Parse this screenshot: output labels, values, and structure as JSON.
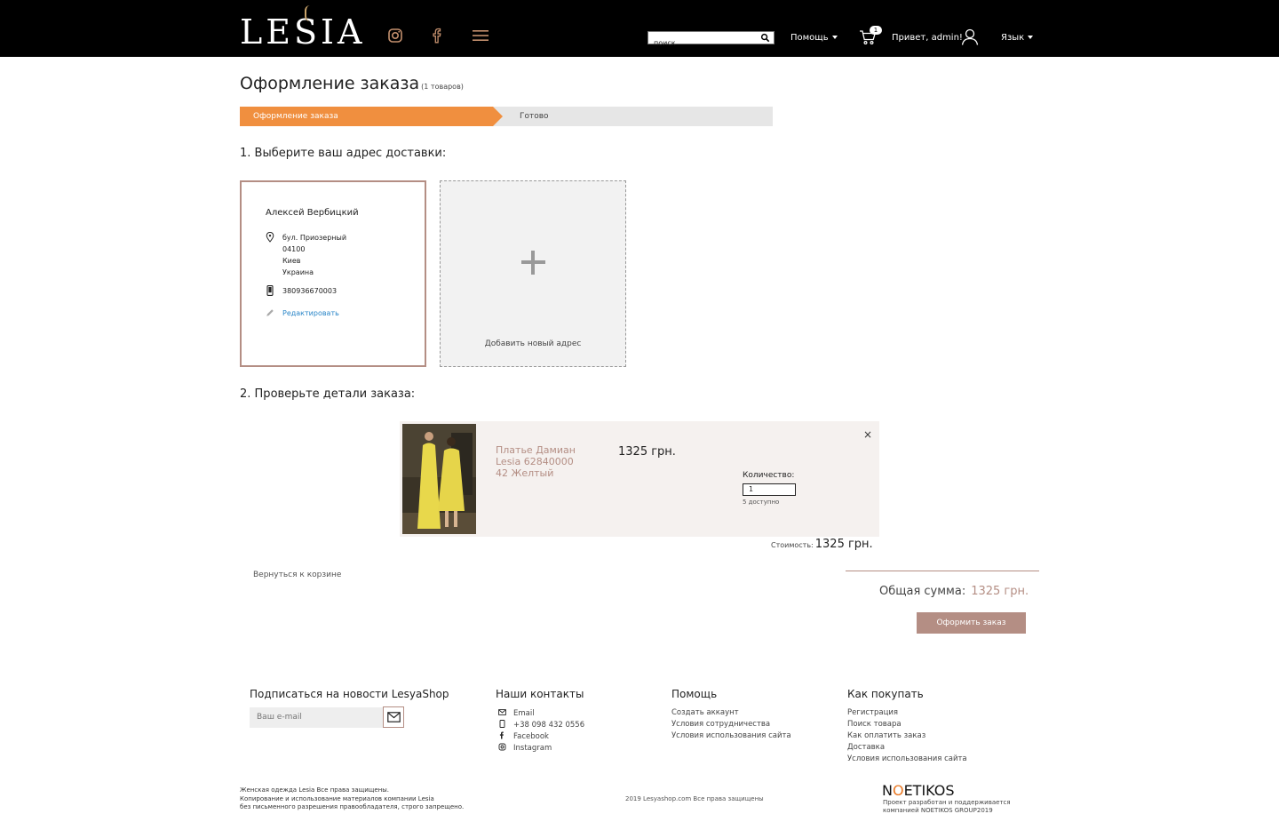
{
  "header": {
    "logo": "LESIA",
    "search_placeholder": "поиск",
    "help_label": "Помощь",
    "cart_count": "1",
    "greeting": "Привет, admin!",
    "language_label": "Язык"
  },
  "page": {
    "title": "Оформление заказа",
    "count": "(1 товаров)",
    "steps": [
      "Оформление заказа",
      "Готово"
    ]
  },
  "delivery": {
    "section_title": "1. Выберите ваш адрес доставки:",
    "address": {
      "name": "Алексей Вербицкий",
      "lines": [
        "бул. Приозерный",
        "04100",
        "Киев",
        "Украина"
      ],
      "phone": "380936670003",
      "edit_label": "Редактировать"
    },
    "add_label": "Добавить новый адрес"
  },
  "order": {
    "section_title": "2. Проверьте детали заказа:",
    "item": {
      "name_lines": [
        "Платье Дамиан",
        "Lesia 62840000",
        "42 Желтый"
      ],
      "price": "1325 грн.",
      "qty_label": "Количество:",
      "qty_value": "1",
      "available": "5 доступно",
      "close": "×"
    },
    "cost_label": "Стоимость:",
    "cost_value": "1325 грн.",
    "back_link": "Вернуться к корзине",
    "total_label": "Общая сумма:",
    "total_value": "1325 грн.",
    "submit_label": "Оформить заказ"
  },
  "footer": {
    "subscribe_title": "Подписаться на новости LesyaShop",
    "email_placeholder": "Ваш e-mail",
    "contacts_title": "Наши контакты",
    "contacts": [
      "Email",
      "+38 098 432 0556",
      "Facebook",
      "Instagram"
    ],
    "help_title": "Помощь",
    "help_links": [
      "Создать аккаунт",
      "Условия сотрудничества",
      "Условия использования сайта"
    ],
    "buy_title": "Как покупать",
    "buy_links": [
      "Регистрация",
      "Поиск товара",
      "Как оплатить заказ",
      "Доставка",
      "Условия использования сайта"
    ],
    "legal_lines": [
      "Женская одежда Lesia Все права защищены.",
      "Копирование и использование материалов компании Lesia",
      "без письменного разрешения правообладателя, строго запрещено."
    ],
    "copyright": "2019 Lesyashop.com Все права защищены",
    "dev_logo": "NOETIKOS",
    "dev_lines": [
      "Проект разработан и поддерживается",
      "компанией NOETIKOS GROUP2019"
    ]
  },
  "colors": {
    "accent": "#b48e84",
    "step_active": "#f08f3f",
    "header_bg": "#000000",
    "link": "#2a86c8"
  }
}
